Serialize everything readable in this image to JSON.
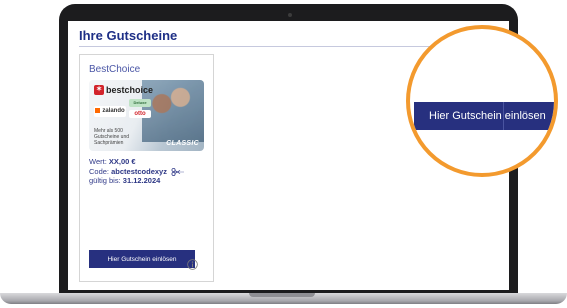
{
  "page": {
    "title": "Ihre Gutscheine"
  },
  "voucher_card": {
    "brand": "BestChoice",
    "image": {
      "logo_text": "bestchoice",
      "partner_1": "zalando",
      "partner_2": "Deluxe",
      "partner_3": "otto",
      "blurb": "Mehr als 500 Gutscheine und Sachprämien",
      "edition": "CLASSIC"
    },
    "value_label": "Wert:",
    "value": "XX,00 €",
    "code_label": "Code:",
    "code": "abctestcodexyz",
    "valid_label": "gültig bis:",
    "valid_until": "31.12.2024",
    "redeem_label": "Hier Gutschein einlösen",
    "info_icon": "info-circle-icon",
    "copy_icon": "scissors-icon"
  },
  "zoom_callout": {
    "button_label_part1": "Hier Gutschein",
    "button_label_part2": "einlösen",
    "ring_color": "#f39a2e"
  },
  "colors": {
    "primary": "#27307f",
    "heading": "#1e2f86",
    "accent": "#f39a2e"
  }
}
